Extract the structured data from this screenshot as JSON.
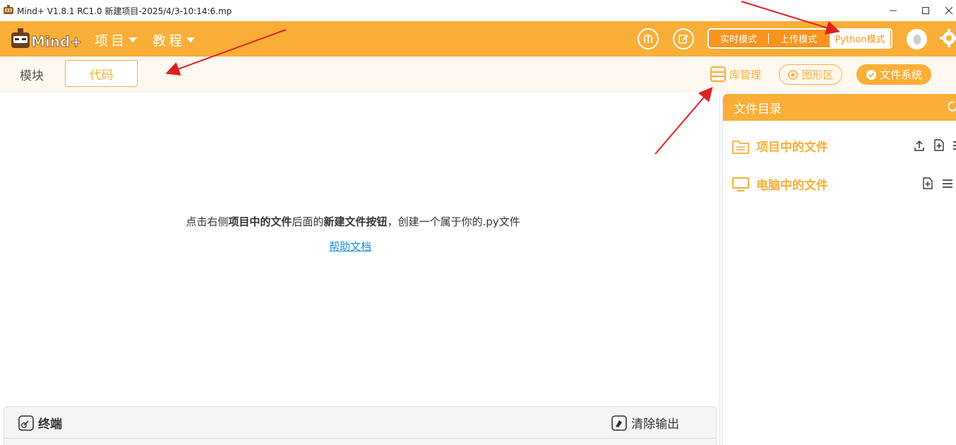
{
  "window": {
    "title": "Mind+ V1.8.1 RC1.0   新建项目-2025/4/3-10:14:6.mp",
    "minimize_icon": "minimize-icon",
    "maximize_icon": "maximize-icon",
    "close_icon": "close-icon"
  },
  "header": {
    "logo_icon": "mindplus-logo-icon",
    "menus": [
      {
        "label": "项目"
      },
      {
        "label": "教程"
      }
    ],
    "modes": [
      {
        "label": "实时模式"
      },
      {
        "label": "上传模式"
      },
      {
        "label": "Python模式",
        "active": true
      }
    ],
    "icons": [
      "chart-icon",
      "edit-icon",
      "avatar-icon",
      "gear-icon"
    ]
  },
  "tabbar": {
    "tabs": [
      {
        "label": "模块"
      },
      {
        "label": "代码",
        "active": true
      }
    ],
    "library_label": "库管理",
    "graphics_label": "图形区",
    "filesystem_label": "文件系统"
  },
  "editor": {
    "hint_prefix": "点击右侧",
    "hint_bold1": "项目中的文件",
    "hint_mid": "后面的",
    "hint_bold2": "新建文件按钮",
    "hint_suffix": "，创建一个属于你的.py文件",
    "help_link": "帮助文档"
  },
  "terminal": {
    "title": "终端",
    "clear_label": "清除输出"
  },
  "files": {
    "title": "文件目录",
    "project_files": "项目中的文件",
    "computer_files": "电脑中的文件"
  },
  "colors": {
    "accent": "#f9ae37",
    "mode_bg": "#f7941e",
    "link": "#1a8fd6",
    "annotation_arrow": "#e02020"
  }
}
